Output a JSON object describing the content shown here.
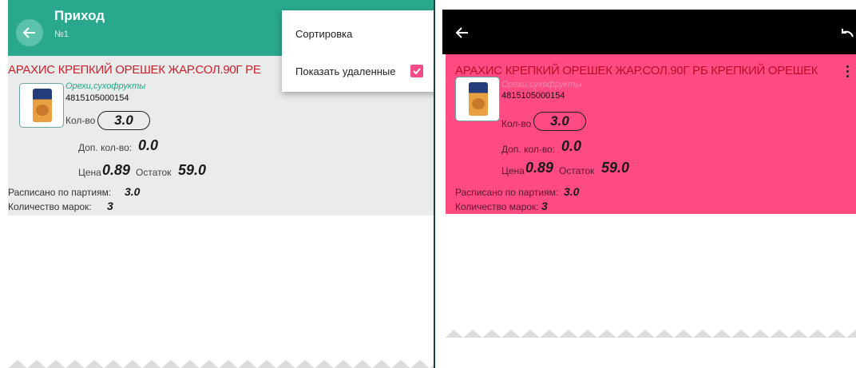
{
  "left": {
    "title": "Приход",
    "subtitle": "№1",
    "product_name": "АРАХИС КРЕПКИЙ ОРЕШЕК ЖАР.СОЛ.90Г РЕ",
    "category": "Орехи,сухофрукты",
    "barcode": "4815105000154",
    "qty_label": "Кол-во",
    "qty_value": "3.0",
    "extra_qty_label": "Доп. кол-во:",
    "extra_qty_value": "0.0",
    "price_label": "Цена",
    "price_value": "0.89",
    "stock_label": "Остаток",
    "stock_value": "59.0",
    "batches_label": "Расписано по партиям:",
    "batches_value": "3.0",
    "marks_label": "Количество марок:",
    "marks_value": "3",
    "menu": {
      "sort_label": "Сортировка",
      "show_deleted_label": "Показать удаленные",
      "show_deleted_checked": true
    }
  },
  "right": {
    "product_name": "АРАХИС КРЕПКИЙ ОРЕШЕК ЖАР.СОЛ.90Г РБ КРЕПКИЙ ОРЕШЕК",
    "category": "Орехи,сухофрукты",
    "barcode": "4815105000154",
    "qty_label": "Кол-во",
    "qty_value": "3.0",
    "extra_qty_label": "Доп. кол-во:",
    "extra_qty_value": "0.0",
    "price_label": "Цена",
    "price_value": "0.89",
    "stock_label": "Остаток",
    "stock_value": "59.0",
    "batches_label": "Расписано по партиям:",
    "batches_value": "3.0",
    "marks_label": "Количество марок:",
    "marks_value": "3"
  },
  "colors": {
    "appbar_left": "#2aa88d",
    "appbar_right": "#000000",
    "card_left": "#e9ecea",
    "card_right_deleted": "#ff4a82",
    "product_name_left": "#cc1f2c",
    "product_name_right": "#b5102a",
    "category_left": "#1aa88a",
    "category_right": "#e98ab0",
    "checkbox": "#f24a8a"
  },
  "icons": [
    "back-arrow-icon",
    "undo-icon",
    "more-vert-icon",
    "checkbox-checked-icon",
    "product-thumbnail"
  ]
}
